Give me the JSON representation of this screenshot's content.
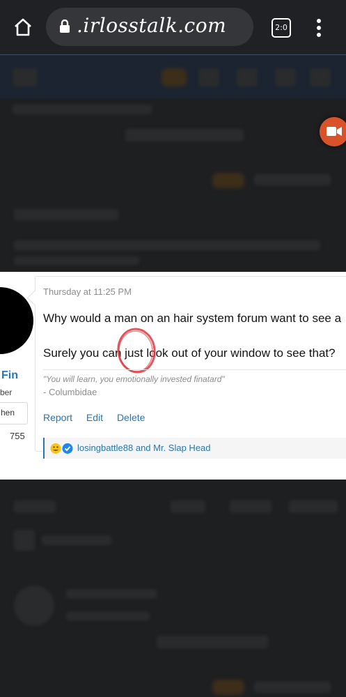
{
  "browser": {
    "url": ".irlosstalk.com",
    "tab_count": "2:0"
  },
  "post": {
    "date": "Thursday at 11:25 PM",
    "body_line1": "Why would a man on an hair system forum want to see a",
    "body_line2": "Surely you can just look out of your window to see that?",
    "signature_quote": "\"You will learn, you emotionally invested finatard\"",
    "signature_author": "- Columbidae",
    "actions": [
      "Report",
      "Edit",
      "Delete"
    ],
    "reactions_text": "losingbattle88 and Mr. Slap Head"
  },
  "user": {
    "name": "Fin",
    "title": "ber",
    "badge": "hen",
    "post_count": "755"
  },
  "colors": {
    "link": "#2577b1",
    "annotation": "#e0373f",
    "chrome_bg": "#202124",
    "fab": "#d9532a"
  }
}
